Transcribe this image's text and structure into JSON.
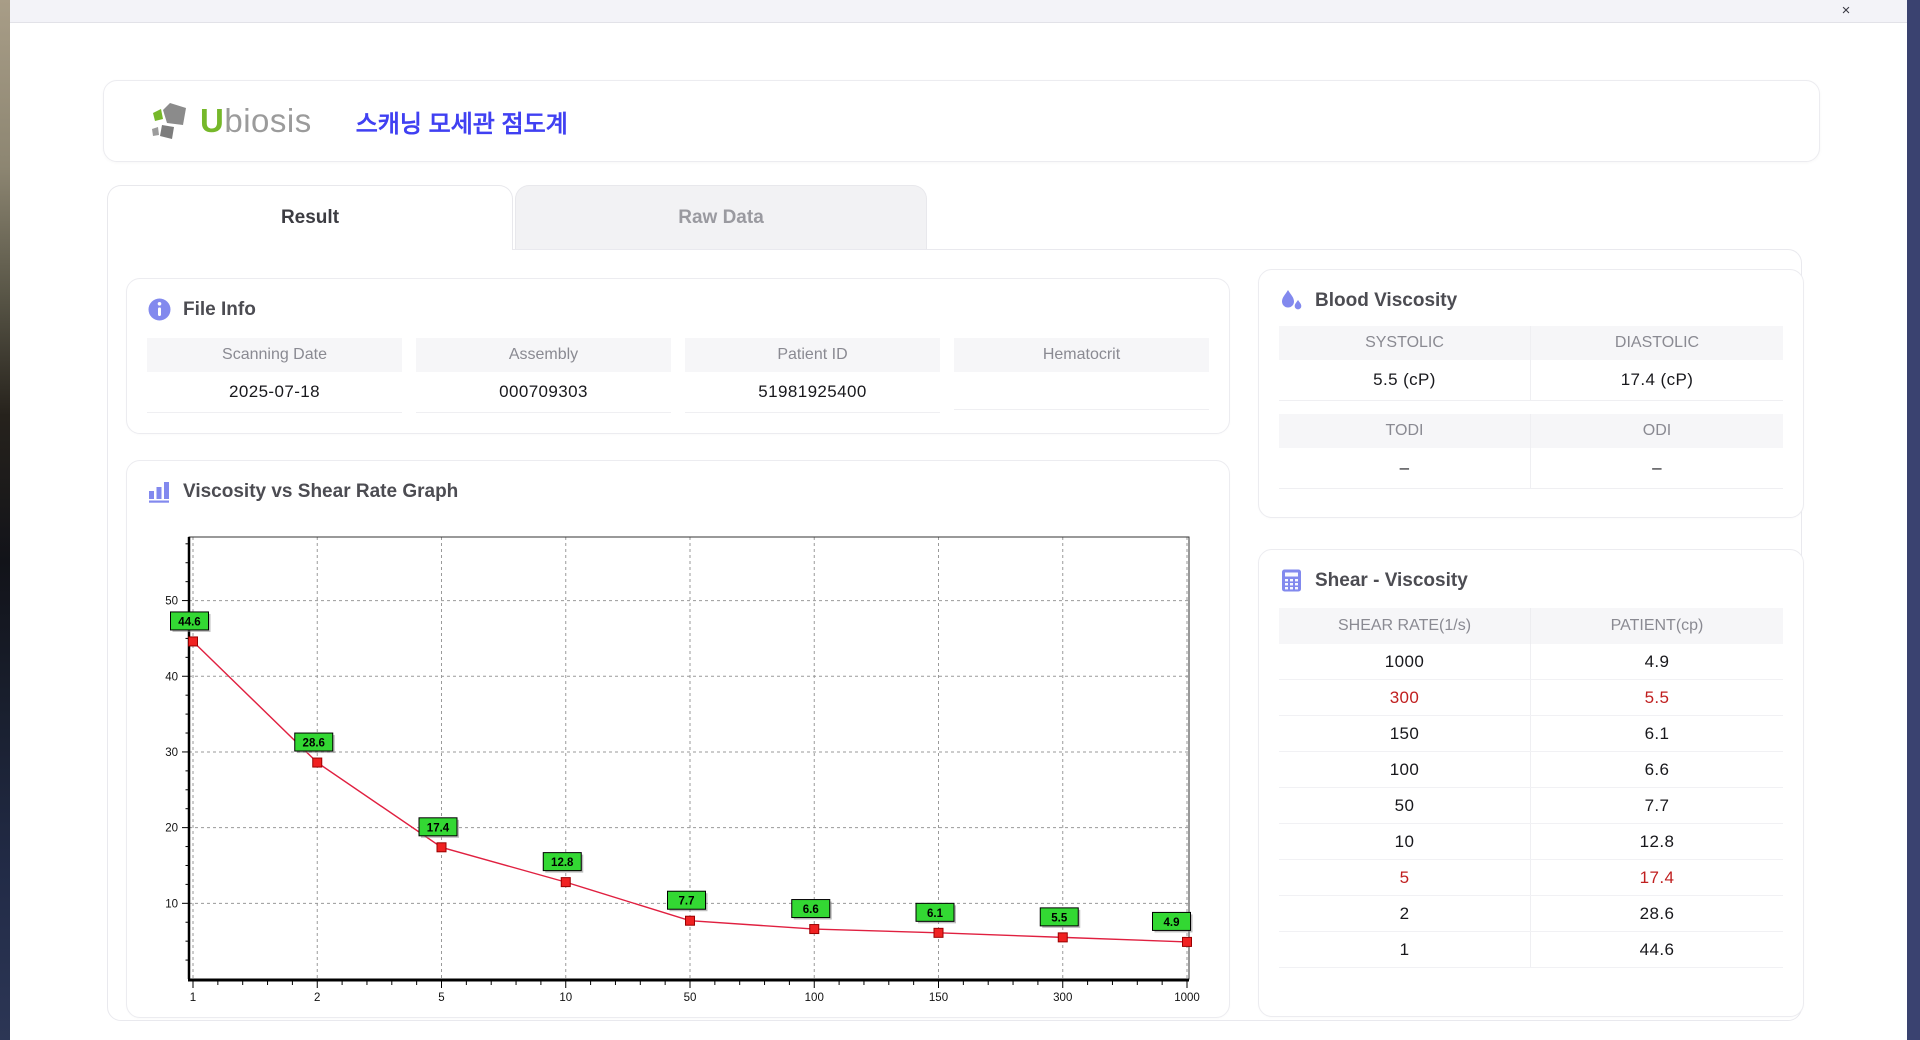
{
  "titlebar": {
    "close_glyph": "×",
    "close_icon": "close-icon"
  },
  "header": {
    "logo_u": "U",
    "logo_rest": "biosis",
    "logo_icon": "ubiosis-logo-icon",
    "app_title": "스캐닝 모세관 점도계"
  },
  "tabs": [
    {
      "label": "Result",
      "active": true
    },
    {
      "label": "Raw Data",
      "active": false
    }
  ],
  "file_info": {
    "title": "File Info",
    "icon": "info-icon",
    "fields": [
      {
        "label": "Scanning Date",
        "value": "2025-07-18"
      },
      {
        "label": "Assembly",
        "value": "000709303"
      },
      {
        "label": "Patient ID",
        "value": "51981925400"
      },
      {
        "label": "Hematocrit",
        "value": ""
      }
    ]
  },
  "blood_viscosity": {
    "title": "Blood Viscosity",
    "icon": "water-drops-icon",
    "groups": [
      {
        "cols": [
          {
            "label": "SYSTOLIC",
            "value": "5.5 (cP)"
          },
          {
            "label": "DIASTOLIC",
            "value": "17.4 (cP)"
          }
        ]
      },
      {
        "cols": [
          {
            "label": "TODI",
            "value": "–"
          },
          {
            "label": "ODI",
            "value": "–"
          }
        ]
      }
    ]
  },
  "graph": {
    "title": "Viscosity vs Shear Rate Graph",
    "icon": "bar-chart-icon"
  },
  "chart_data": {
    "type": "line",
    "title": "Viscosity vs Shear Rate Graph",
    "x": [
      1,
      2,
      5,
      10,
      50,
      100,
      150,
      300,
      1000
    ],
    "y": [
      44.6,
      28.6,
      17.4,
      12.8,
      7.7,
      6.6,
      6.1,
      5.5,
      4.9
    ],
    "point_labels": [
      "44.6",
      "28.6",
      "17.4",
      "12.8",
      "7.7",
      "6.6",
      "6.1",
      "5.5",
      "4.9"
    ],
    "x_tick_labels": [
      "1",
      "2",
      "5",
      "10",
      "50",
      "100",
      "150",
      "300",
      "1000"
    ],
    "y_ticks": [
      10,
      20,
      30,
      40,
      50
    ],
    "ylim": [
      0,
      58.4
    ],
    "x_scale": "equal-spaced-ticks",
    "grid": true,
    "xlabel": "",
    "ylabel": "",
    "legend": "none",
    "line_color": "#e02040",
    "marker_color": "#f02222",
    "marker_stroke": "#990000",
    "label_bg": "#33d833",
    "label_border": "#000000"
  },
  "shear_viscosity": {
    "title": "Shear - Viscosity",
    "icon": "calculator-icon",
    "columns": [
      "SHEAR RATE(1/s)",
      "PATIENT(cp)"
    ],
    "rows": [
      {
        "shear_rate": "1000",
        "patient": "4.9",
        "highlight": false
      },
      {
        "shear_rate": "300",
        "patient": "5.5",
        "highlight": true
      },
      {
        "shear_rate": "150",
        "patient": "6.1",
        "highlight": false
      },
      {
        "shear_rate": "100",
        "patient": "6.6",
        "highlight": false
      },
      {
        "shear_rate": "50",
        "patient": "7.7",
        "highlight": false
      },
      {
        "shear_rate": "10",
        "patient": "12.8",
        "highlight": false
      },
      {
        "shear_rate": "5",
        "patient": "17.4",
        "highlight": true
      },
      {
        "shear_rate": "2",
        "patient": "28.6",
        "highlight": false
      },
      {
        "shear_rate": "1",
        "patient": "44.6",
        "highlight": false
      }
    ]
  },
  "colors": {
    "accent_purple": "#8289ee",
    "title_blue": "#4040f2",
    "logo_green": "#76b82a",
    "logo_gray": "#9b9b9b",
    "highlight_red": "#c01f1f",
    "cell_bg": "#f6f6f8"
  }
}
